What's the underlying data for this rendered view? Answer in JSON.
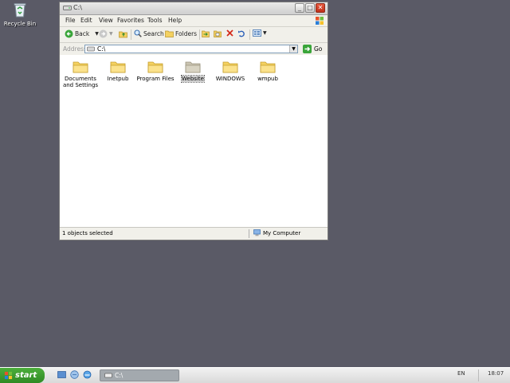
{
  "desktop": {
    "recycle_bin_label": "Recycle Bin"
  },
  "window": {
    "title": "C:\\",
    "menu": [
      "File",
      "Edit",
      "View",
      "Favorites",
      "Tools",
      "Help"
    ],
    "toolbar": {
      "back_label": "Back",
      "search_label": "Search",
      "folders_label": "Folders"
    },
    "address": {
      "label": "Address",
      "value": "C:\\",
      "go_label": "Go"
    },
    "folders": [
      {
        "name": "Documents and Settings",
        "lines": [
          "Documents",
          "and Settings"
        ],
        "selected": false
      },
      {
        "name": "Inetpub",
        "lines": [
          "Inetpub"
        ],
        "selected": false
      },
      {
        "name": "Program Files",
        "lines": [
          "Program Files"
        ],
        "selected": false
      },
      {
        "name": "Website",
        "lines": [
          "Website"
        ],
        "selected": true
      },
      {
        "name": "WINDOWS",
        "lines": [
          "WINDOWS"
        ],
        "selected": false
      },
      {
        "name": "wmpub",
        "lines": [
          "wmpub"
        ],
        "selected": false
      }
    ],
    "status": {
      "left": "1 objects selected",
      "right": "My Computer"
    }
  },
  "taskbar": {
    "start_label": "start",
    "task_label": "C:\\",
    "language": "EN",
    "clock": "18:07"
  },
  "colors": {
    "desktop": "#5a5a66",
    "start": "#3a9a2e",
    "folder": "#f4d160",
    "selected_folder": "#c9c3b0"
  }
}
